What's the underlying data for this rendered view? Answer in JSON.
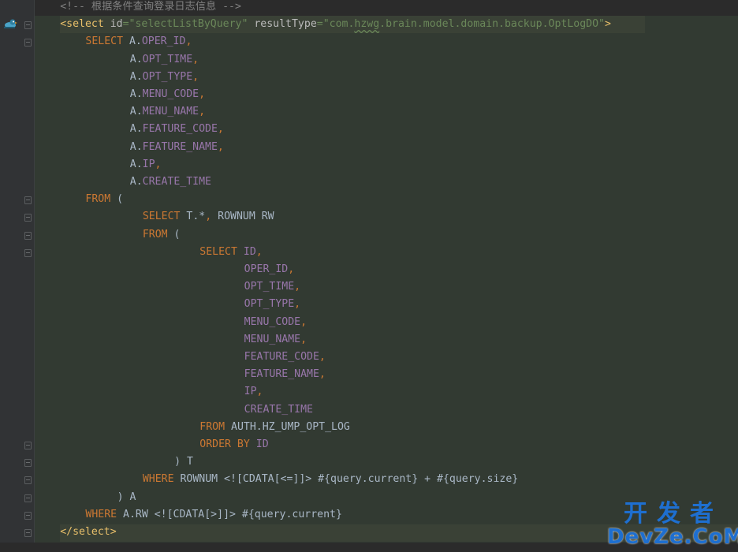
{
  "editor": {
    "lines": [
      {
        "indent": 4,
        "tokens": [
          {
            "t": "<!-- 根据条件查询登录日志信息 -->",
            "c": "cmt"
          }
        ]
      },
      {
        "indent": 4,
        "tokens": [
          {
            "t": "<select ",
            "c": "tag"
          },
          {
            "t": "id",
            "c": "attr"
          },
          {
            "t": "=\"selectListByQuery\"",
            "c": "str"
          },
          {
            "t": " ",
            "c": "plain"
          },
          {
            "t": "resultType",
            "c": "attr"
          },
          {
            "t": "=\"com.",
            "c": "str"
          },
          {
            "t": "hzwg",
            "c": "str wavy"
          },
          {
            "t": ".brain.model.domain.backup.OptLogDO\"",
            "c": "str"
          },
          {
            "t": ">",
            "c": "tag"
          }
        ]
      },
      {
        "indent": 8,
        "tokens": [
          {
            "t": "SELECT ",
            "c": "kw"
          },
          {
            "t": "A.",
            "c": "plain"
          },
          {
            "t": "OPER_ID",
            "c": "col"
          },
          {
            "t": ",",
            "c": "punct"
          }
        ]
      },
      {
        "indent": 15,
        "tokens": [
          {
            "t": "A.",
            "c": "plain"
          },
          {
            "t": "OPT_TIME",
            "c": "col"
          },
          {
            "t": ",",
            "c": "punct"
          }
        ]
      },
      {
        "indent": 15,
        "tokens": [
          {
            "t": "A.",
            "c": "plain"
          },
          {
            "t": "OPT_TYPE",
            "c": "col"
          },
          {
            "t": ",",
            "c": "punct"
          }
        ]
      },
      {
        "indent": 15,
        "tokens": [
          {
            "t": "A.",
            "c": "plain"
          },
          {
            "t": "MENU_CODE",
            "c": "col"
          },
          {
            "t": ",",
            "c": "punct"
          }
        ]
      },
      {
        "indent": 15,
        "tokens": [
          {
            "t": "A.",
            "c": "plain"
          },
          {
            "t": "MENU_NAME",
            "c": "col"
          },
          {
            "t": ",",
            "c": "punct"
          }
        ]
      },
      {
        "indent": 15,
        "tokens": [
          {
            "t": "A.",
            "c": "plain"
          },
          {
            "t": "FEATURE_CODE",
            "c": "col"
          },
          {
            "t": ",",
            "c": "punct"
          }
        ]
      },
      {
        "indent": 15,
        "tokens": [
          {
            "t": "A.",
            "c": "plain"
          },
          {
            "t": "FEATURE_NAME",
            "c": "col"
          },
          {
            "t": ",",
            "c": "punct"
          }
        ]
      },
      {
        "indent": 15,
        "tokens": [
          {
            "t": "A.",
            "c": "plain"
          },
          {
            "t": "IP",
            "c": "col"
          },
          {
            "t": ",",
            "c": "punct"
          }
        ]
      },
      {
        "indent": 15,
        "tokens": [
          {
            "t": "A.",
            "c": "plain"
          },
          {
            "t": "CREATE_TIME",
            "c": "col"
          }
        ]
      },
      {
        "indent": 8,
        "tokens": [
          {
            "t": "FROM ",
            "c": "kw"
          },
          {
            "t": "(",
            "c": "plain"
          }
        ]
      },
      {
        "indent": 17,
        "tokens": [
          {
            "t": "SELECT ",
            "c": "kw"
          },
          {
            "t": "T.*",
            "c": "plain"
          },
          {
            "t": ", ",
            "c": "punct"
          },
          {
            "t": "ROWNUM RW",
            "c": "plain"
          }
        ]
      },
      {
        "indent": 17,
        "tokens": [
          {
            "t": "FROM ",
            "c": "kw"
          },
          {
            "t": "(",
            "c": "plain"
          }
        ]
      },
      {
        "indent": 26,
        "tokens": [
          {
            "t": "SELECT ",
            "c": "kw"
          },
          {
            "t": "ID",
            "c": "col"
          },
          {
            "t": ",",
            "c": "punct"
          }
        ]
      },
      {
        "indent": 33,
        "tokens": [
          {
            "t": "OPER_ID",
            "c": "col"
          },
          {
            "t": ",",
            "c": "punct"
          }
        ]
      },
      {
        "indent": 33,
        "tokens": [
          {
            "t": "OPT_TIME",
            "c": "col"
          },
          {
            "t": ",",
            "c": "punct"
          }
        ]
      },
      {
        "indent": 33,
        "tokens": [
          {
            "t": "OPT_TYPE",
            "c": "col"
          },
          {
            "t": ",",
            "c": "punct"
          }
        ]
      },
      {
        "indent": 33,
        "tokens": [
          {
            "t": "MENU_CODE",
            "c": "col"
          },
          {
            "t": ",",
            "c": "punct"
          }
        ]
      },
      {
        "indent": 33,
        "tokens": [
          {
            "t": "MENU_NAME",
            "c": "col"
          },
          {
            "t": ",",
            "c": "punct"
          }
        ]
      },
      {
        "indent": 33,
        "tokens": [
          {
            "t": "FEATURE_CODE",
            "c": "col"
          },
          {
            "t": ",",
            "c": "punct"
          }
        ]
      },
      {
        "indent": 33,
        "tokens": [
          {
            "t": "FEATURE_NAME",
            "c": "col"
          },
          {
            "t": ",",
            "c": "punct"
          }
        ]
      },
      {
        "indent": 33,
        "tokens": [
          {
            "t": "IP",
            "c": "col"
          },
          {
            "t": ",",
            "c": "punct"
          }
        ]
      },
      {
        "indent": 33,
        "tokens": [
          {
            "t": "CREATE_TIME",
            "c": "col"
          }
        ]
      },
      {
        "indent": 26,
        "tokens": [
          {
            "t": "FROM ",
            "c": "kw"
          },
          {
            "t": "AUTH.HZ_UMP_OPT_LOG",
            "c": "plain"
          }
        ]
      },
      {
        "indent": 26,
        "tokens": [
          {
            "t": "ORDER BY ",
            "c": "kw"
          },
          {
            "t": "ID",
            "c": "col"
          }
        ]
      },
      {
        "indent": 22,
        "tokens": [
          {
            "t": ") T",
            "c": "plain"
          }
        ]
      },
      {
        "indent": 17,
        "tokens": [
          {
            "t": "WHERE ",
            "c": "kw"
          },
          {
            "t": "ROWNUM <![CDATA[<=]]> #{query.current} + #{query.size}",
            "c": "plain"
          }
        ]
      },
      {
        "indent": 13,
        "tokens": [
          {
            "t": ") A",
            "c": "plain"
          }
        ]
      },
      {
        "indent": 8,
        "tokens": [
          {
            "t": "WHERE ",
            "c": "kw"
          },
          {
            "t": "A.RW <![CDATA[>]]> #{query.current}",
            "c": "plain"
          }
        ]
      },
      {
        "indent": 4,
        "tokens": [
          {
            "t": "</select>",
            "c": "tag"
          }
        ]
      }
    ]
  },
  "watermark": {
    "cn": "开发者",
    "en": "DevZe.CoM"
  },
  "icons": {
    "gutter_marker": "debug-duck-icon",
    "fold_marker": "fold-marker-icon"
  }
}
